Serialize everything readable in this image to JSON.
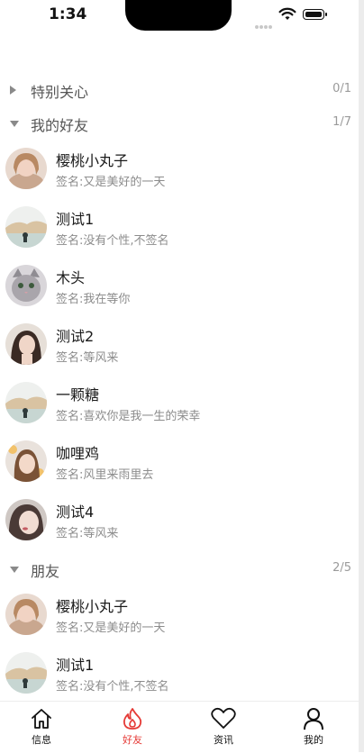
{
  "status_bar": {
    "time": "1:34"
  },
  "groups": [
    {
      "name": "特别关心",
      "count": "0/1",
      "expanded": false
    },
    {
      "name": "我的好友",
      "count": "1/7",
      "expanded": true
    },
    {
      "name": "朋友",
      "count": "2/5",
      "expanded": true
    }
  ],
  "my_friends": [
    {
      "name": "樱桃小丸子",
      "signature": "签名:又是美好的一天",
      "avatar": "girl-portrait-avatar"
    },
    {
      "name": "测试1",
      "signature": "签名:没有个性,不签名",
      "avatar": "landscape-avatar"
    },
    {
      "name": "木头",
      "signature": "签名:我在等你",
      "avatar": "cat-avatar"
    },
    {
      "name": "测试2",
      "signature": "签名:等风来",
      "avatar": "girl-portrait-avatar"
    },
    {
      "name": "一颗糖",
      "signature": "签名:喜欢你是我一生的荣幸",
      "avatar": "landscape-avatar"
    },
    {
      "name": "咖哩鸡",
      "signature": "签名:风里来雨里去",
      "avatar": "girl-flowers-avatar"
    },
    {
      "name": "测试4",
      "signature": "签名:等风来",
      "avatar": "girl-portrait-avatar"
    }
  ],
  "friends": [
    {
      "name": "樱桃小丸子",
      "signature": "签名:又是美好的一天",
      "avatar": "girl-portrait-avatar"
    },
    {
      "name": "测试1",
      "signature": "签名:没有个性,不签名",
      "avatar": "landscape-avatar"
    }
  ],
  "tabbar": {
    "items": [
      {
        "label": "信息",
        "icon": "home-icon",
        "active": false
      },
      {
        "label": "好友",
        "icon": "flame-icon",
        "active": true
      },
      {
        "label": "资讯",
        "icon": "heart-icon",
        "active": false
      },
      {
        "label": "我的",
        "icon": "person-icon",
        "active": false
      }
    ],
    "active_color": "#e53935"
  }
}
